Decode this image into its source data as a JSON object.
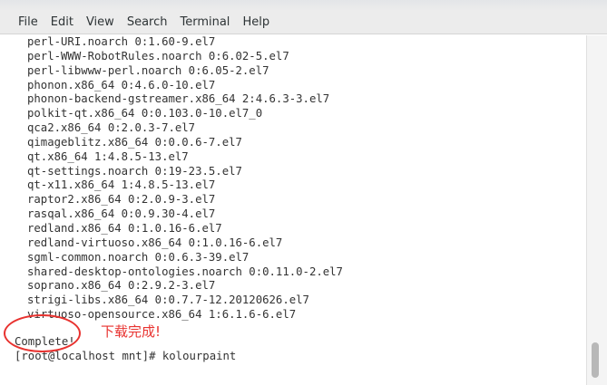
{
  "menu": {
    "items": [
      "File",
      "Edit",
      "View",
      "Search",
      "Terminal",
      "Help"
    ]
  },
  "terminal": {
    "lines": [
      "perl-URI.noarch 0:1.60-9.el7",
      "perl-WWW-RobotRules.noarch 0:6.02-5.el7",
      "perl-libwww-perl.noarch 0:6.05-2.el7",
      "phonon.x86_64 0:4.6.0-10.el7",
      "phonon-backend-gstreamer.x86_64 2:4.6.3-3.el7",
      "polkit-qt.x86_64 0:0.103.0-10.el7_0",
      "qca2.x86_64 0:2.0.3-7.el7",
      "qimageblitz.x86_64 0:0.0.6-7.el7",
      "qt.x86_64 1:4.8.5-13.el7",
      "qt-settings.noarch 0:19-23.5.el7",
      "qt-x11.x86_64 1:4.8.5-13.el7",
      "raptor2.x86_64 0:2.0.9-3.el7",
      "rasqal.x86_64 0:0.9.30-4.el7",
      "redland.x86_64 0:1.0.16-6.el7",
      "redland-virtuoso.x86_64 0:1.0.16-6.el7",
      "sgml-common.noarch 0:0.6.3-39.el7",
      "shared-desktop-ontologies.noarch 0:0.11.0-2.el7",
      "soprano.x86_64 0:2.9.2-3.el7",
      "strigi-libs.x86_64 0:0.7.7-12.20120626.el7",
      "virtuoso-opensource.x86_64 1:6.1.6-6.el7"
    ],
    "status": "Complete!",
    "prompt": "[root@localhost mnt]# kolourpaint"
  },
  "annotation": {
    "text": "下载完成!",
    "color": "#e8322f"
  }
}
